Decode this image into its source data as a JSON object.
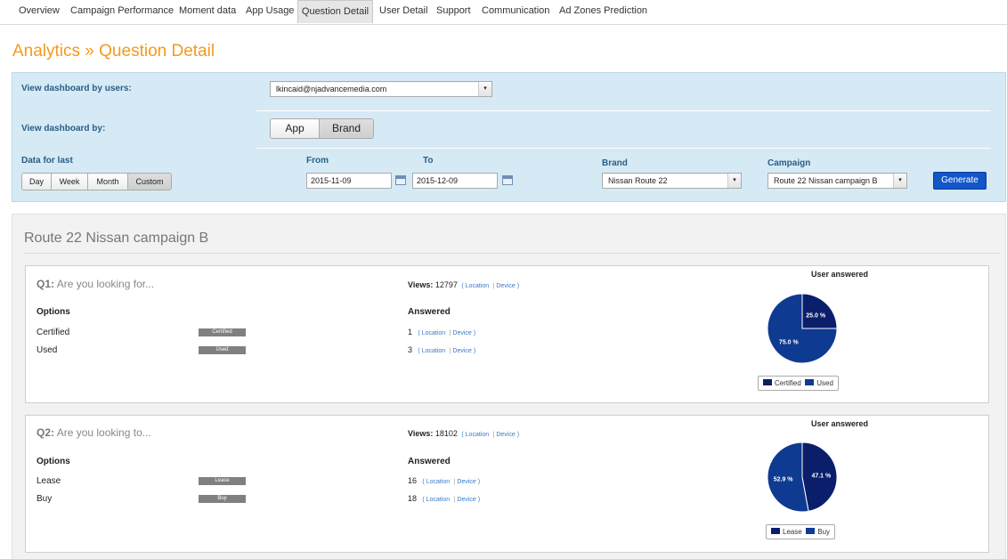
{
  "nav": {
    "tabs": [
      {
        "label": "Overview",
        "active": false
      },
      {
        "label": "Campaign Performance",
        "active": false
      },
      {
        "label": "Moment data",
        "active": false
      },
      {
        "label": "App Usage",
        "active": false
      },
      {
        "label": "Question Detail",
        "active": true
      },
      {
        "label": "User Detail",
        "active": false
      },
      {
        "label": "Support",
        "active": false
      },
      {
        "label": "Communication",
        "active": false
      },
      {
        "label": "Ad Zones Prediction",
        "active": false
      }
    ]
  },
  "page": {
    "title": "Analytics » Question Detail"
  },
  "filters": {
    "users_label": "View dashboard by users:",
    "users_value": "lkincaid@njadvancemedia.com",
    "by_label": "View dashboard by:",
    "by_options": [
      "App",
      "Brand"
    ],
    "by_selected": "Brand",
    "period_label": "Data for last",
    "period_options": [
      "Day",
      "Week",
      "Month",
      "Custom"
    ],
    "period_selected": "Custom",
    "from_label": "From",
    "from_value": "2015-11-09",
    "to_label": "To",
    "to_value": "2015-12-09",
    "brand_label": "Brand",
    "brand_value": "Nissan Route 22",
    "campaign_label": "Campaign",
    "campaign_value": "Route 22 Nissan campaign B",
    "generate_label": "Generate"
  },
  "campaign": {
    "title": "Route 22 Nissan campaign B"
  },
  "labels": {
    "options": "Options",
    "answered": "Answered",
    "views_prefix": "Views:",
    "location": "Location",
    "device": "Device",
    "pie_title": "User answered",
    "arrow": "▾"
  },
  "colors": {
    "dark_navy": "#0b1e6b",
    "mid_navy": "#0e3a91",
    "accent_orange": "#f39a1e",
    "button_blue": "#1256c8"
  },
  "questions": [
    {
      "num": "Q1:",
      "text": "Are you looking for...",
      "views": "12797",
      "options": [
        {
          "label": "Certified",
          "bar": "Certified",
          "answered": "1"
        },
        {
          "label": "Used",
          "bar": "Used",
          "answered": "3"
        }
      ],
      "pie": [
        {
          "name": "Certified",
          "pct": 25.0,
          "label": "25.0 %",
          "color": "#0b1e6b"
        },
        {
          "name": "Used",
          "pct": 75.0,
          "label": "75.0 %",
          "color": "#0e3a91"
        }
      ]
    },
    {
      "num": "Q2:",
      "text": "Are you looking to...",
      "views": "18102",
      "options": [
        {
          "label": "Lease",
          "bar": "Lease",
          "answered": "16"
        },
        {
          "label": "Buy",
          "bar": "Buy",
          "answered": "18"
        }
      ],
      "pie": [
        {
          "name": "Lease",
          "pct": 47.1,
          "label": "47.1 %",
          "color": "#0b1e6b"
        },
        {
          "name": "Buy",
          "pct": 52.9,
          "label": "52.9 %",
          "color": "#0e3a91"
        }
      ]
    }
  ]
}
